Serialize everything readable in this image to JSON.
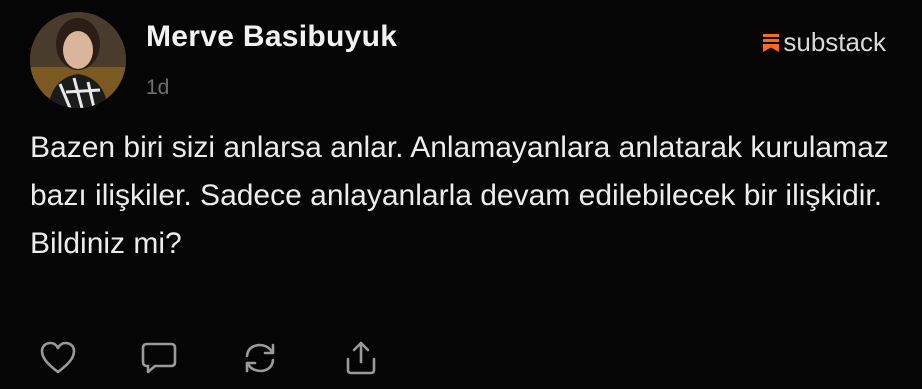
{
  "post": {
    "author": "Merve Basibuyuk",
    "timestamp": "1d",
    "brand": "substack",
    "body": "Bazen biri sizi anlarsa anlar. Anlamayanlara anlatarak kurulamaz bazı ilişkiler. Sadece anlayanlarla devam edilebilecek bir ilişkidir. Bildiniz mi?"
  },
  "actions": [
    {
      "icon": "heart-icon"
    },
    {
      "icon": "comment-icon"
    },
    {
      "icon": "restack-icon"
    },
    {
      "icon": "share-icon"
    }
  ],
  "colors": {
    "background": "#050505",
    "text": "#ececec",
    "muted": "#6f6f6f",
    "brand_accent": "#ff6719",
    "icon": "#9a9a9a"
  }
}
